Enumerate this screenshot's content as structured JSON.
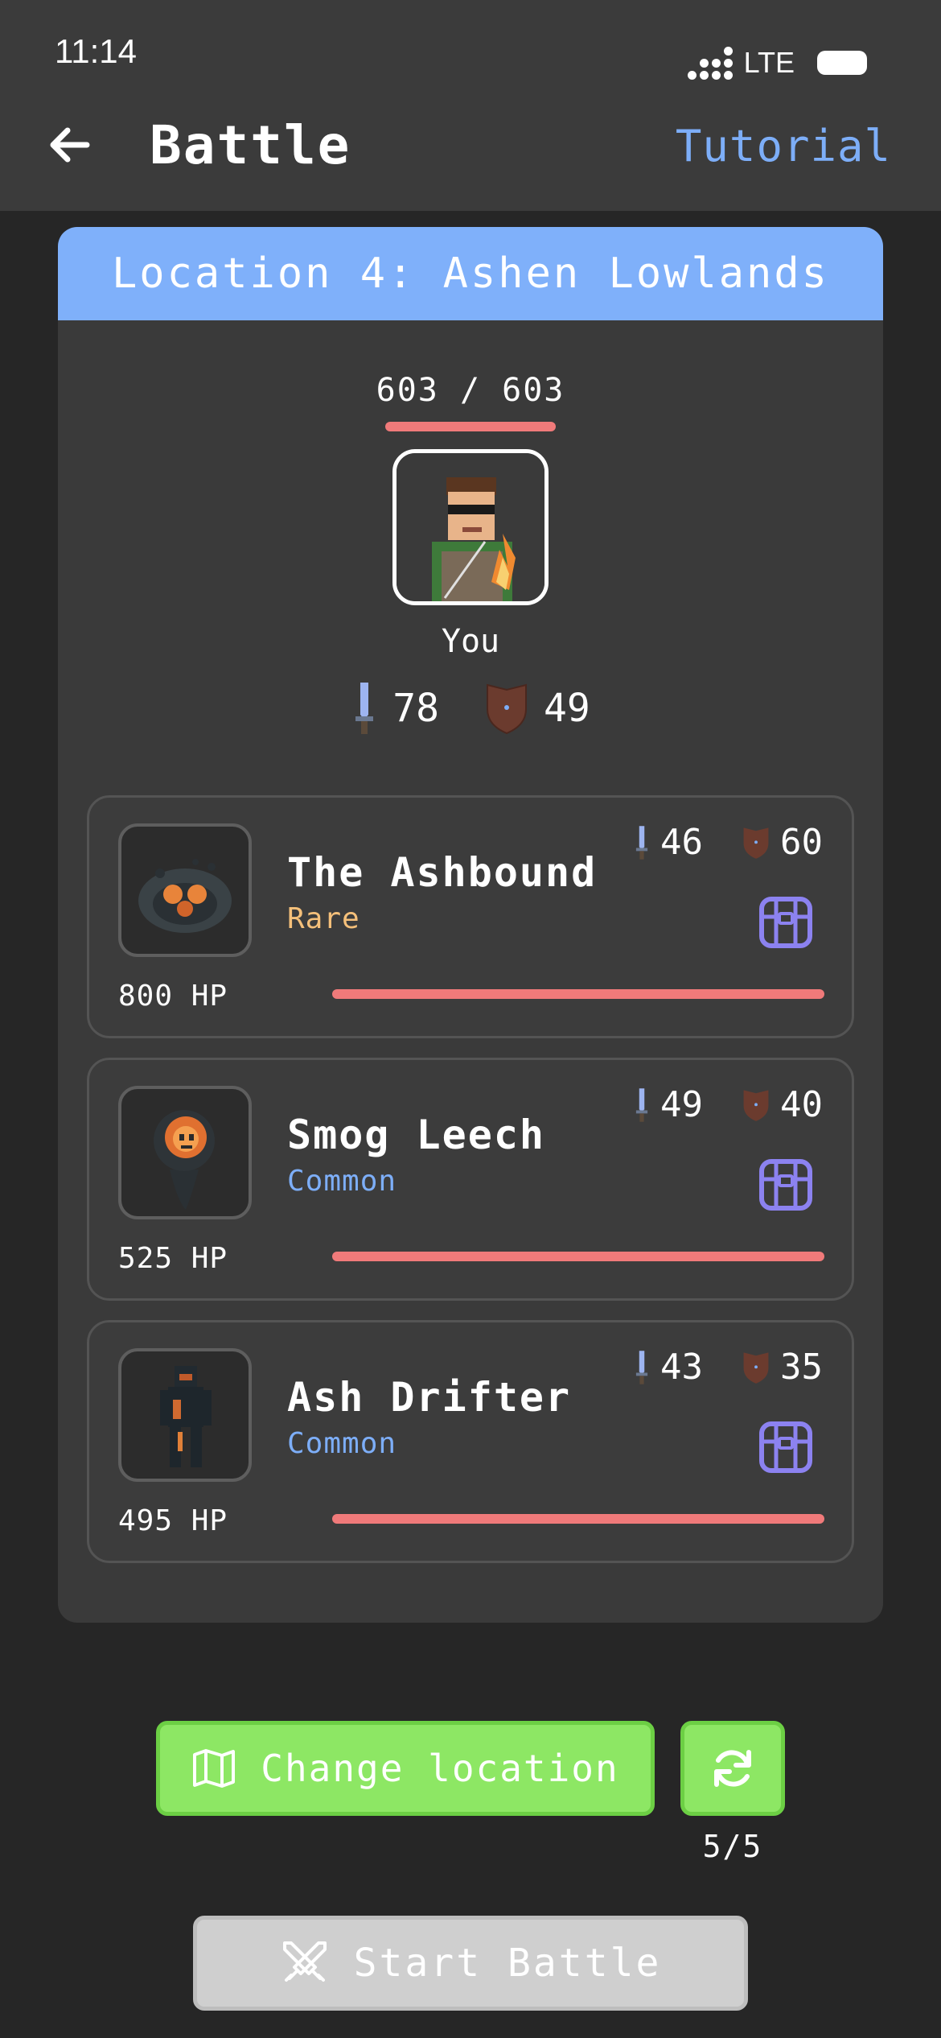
{
  "status": {
    "time": "11:14",
    "network": "LTE"
  },
  "header": {
    "title": "Battle",
    "tutorial_label": "Tutorial"
  },
  "location": {
    "title": "Location 4: Ashen Lowlands"
  },
  "player": {
    "hp_text": "603 / 603",
    "hp_fraction": 1.0,
    "name": "You",
    "attack": "78",
    "defense": "49"
  },
  "enemies": [
    {
      "name": "The Ashbound",
      "rarity": "Rare",
      "rarity_color": "#f5c07a",
      "hp": "800 HP",
      "hp_fraction": 1.0,
      "attack": "46",
      "defense": "60"
    },
    {
      "name": "Smog Leech",
      "rarity": "Common",
      "rarity_color": "#7daef8",
      "hp": "525 HP",
      "hp_fraction": 1.0,
      "attack": "49",
      "defense": "40"
    },
    {
      "name": "Ash Drifter",
      "rarity": "Common",
      "rarity_color": "#7daef8",
      "hp": "495 HP",
      "hp_fraction": 1.0,
      "attack": "43",
      "defense": "35"
    }
  ],
  "buttons": {
    "change_location": "Change location",
    "refresh_count": "5/5",
    "start_battle": "Start Battle"
  },
  "colors": {
    "accent_blue": "#7fb0fa",
    "hp_red": "#f07a7a",
    "button_green": "#8de764",
    "chest_purple": "#8c82f0"
  },
  "icons": {
    "back": "arrow-left-icon",
    "attack": "sword-icon",
    "defense": "shield-icon",
    "loot": "chest-icon",
    "map": "map-icon",
    "refresh": "refresh-icon",
    "battle": "crossed-swords-icon"
  }
}
